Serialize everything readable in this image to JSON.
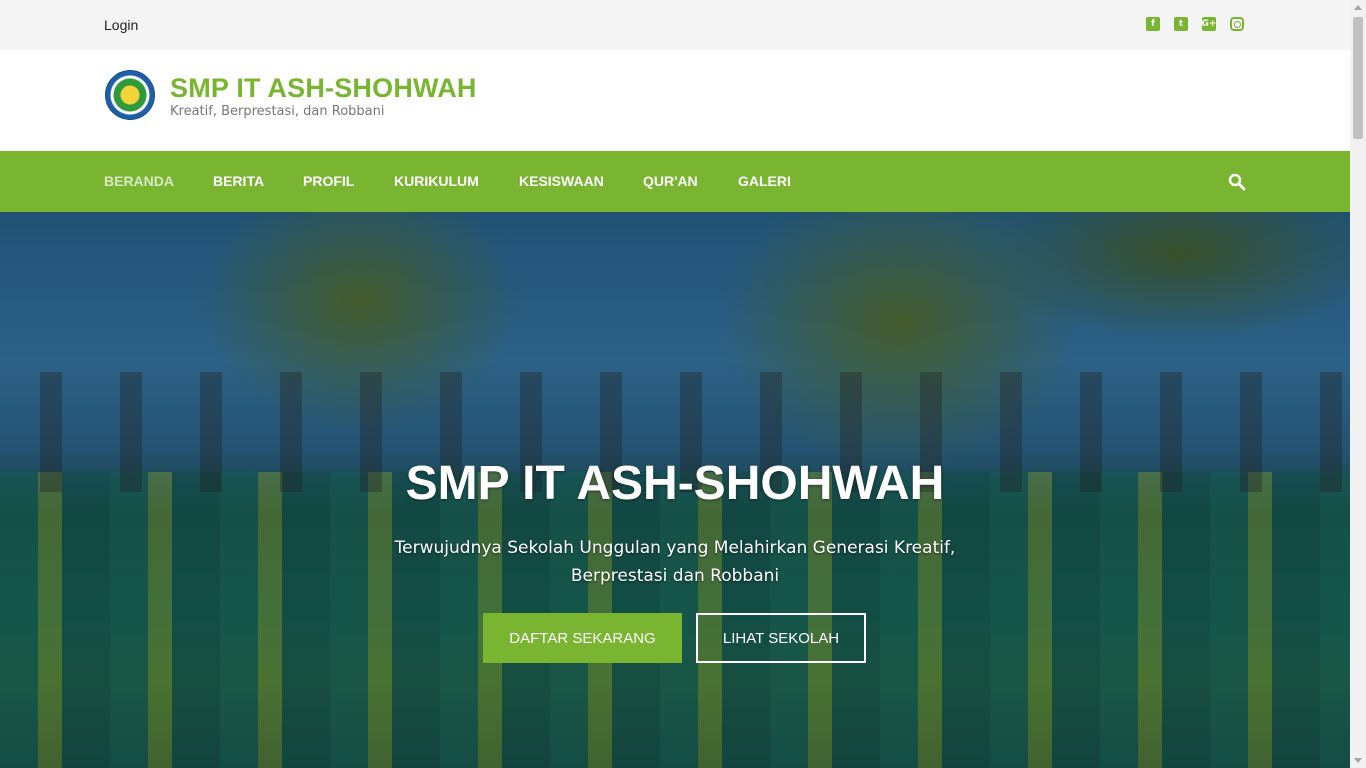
{
  "topbar": {
    "login_label": "Login",
    "social_icons": [
      "facebook-icon",
      "twitter-icon",
      "google-plus-icon",
      "instagram-icon"
    ],
    "social_glyphs": [
      "f",
      "t",
      "G+",
      ""
    ]
  },
  "header": {
    "site_title": "SMP IT ASH-SHOHWAH",
    "tagline": "Kreatif, Berprestasi, dan Robbani"
  },
  "nav": {
    "items": [
      {
        "label": "BERANDA",
        "active": true
      },
      {
        "label": "BERITA"
      },
      {
        "label": "PROFIL"
      },
      {
        "label": "KURIKULUM"
      },
      {
        "label": "KESISWAAN"
      },
      {
        "label": "QUR'AN"
      },
      {
        "label": "GALERI"
      }
    ]
  },
  "hero": {
    "title": "SMP IT ASH-SHOHWAH",
    "text": "Terwujudnya Sekolah Unggulan yang Melahirkan Generasi Kreatif, Berprestasi dan Robbani",
    "primary_button": "DAFTAR SEKARANG",
    "secondary_button": "LIHAT SEKOLAH"
  },
  "colors": {
    "accent": "#7ab532",
    "nav_active_text": "#d8e8c4",
    "tagline": "#777777"
  }
}
